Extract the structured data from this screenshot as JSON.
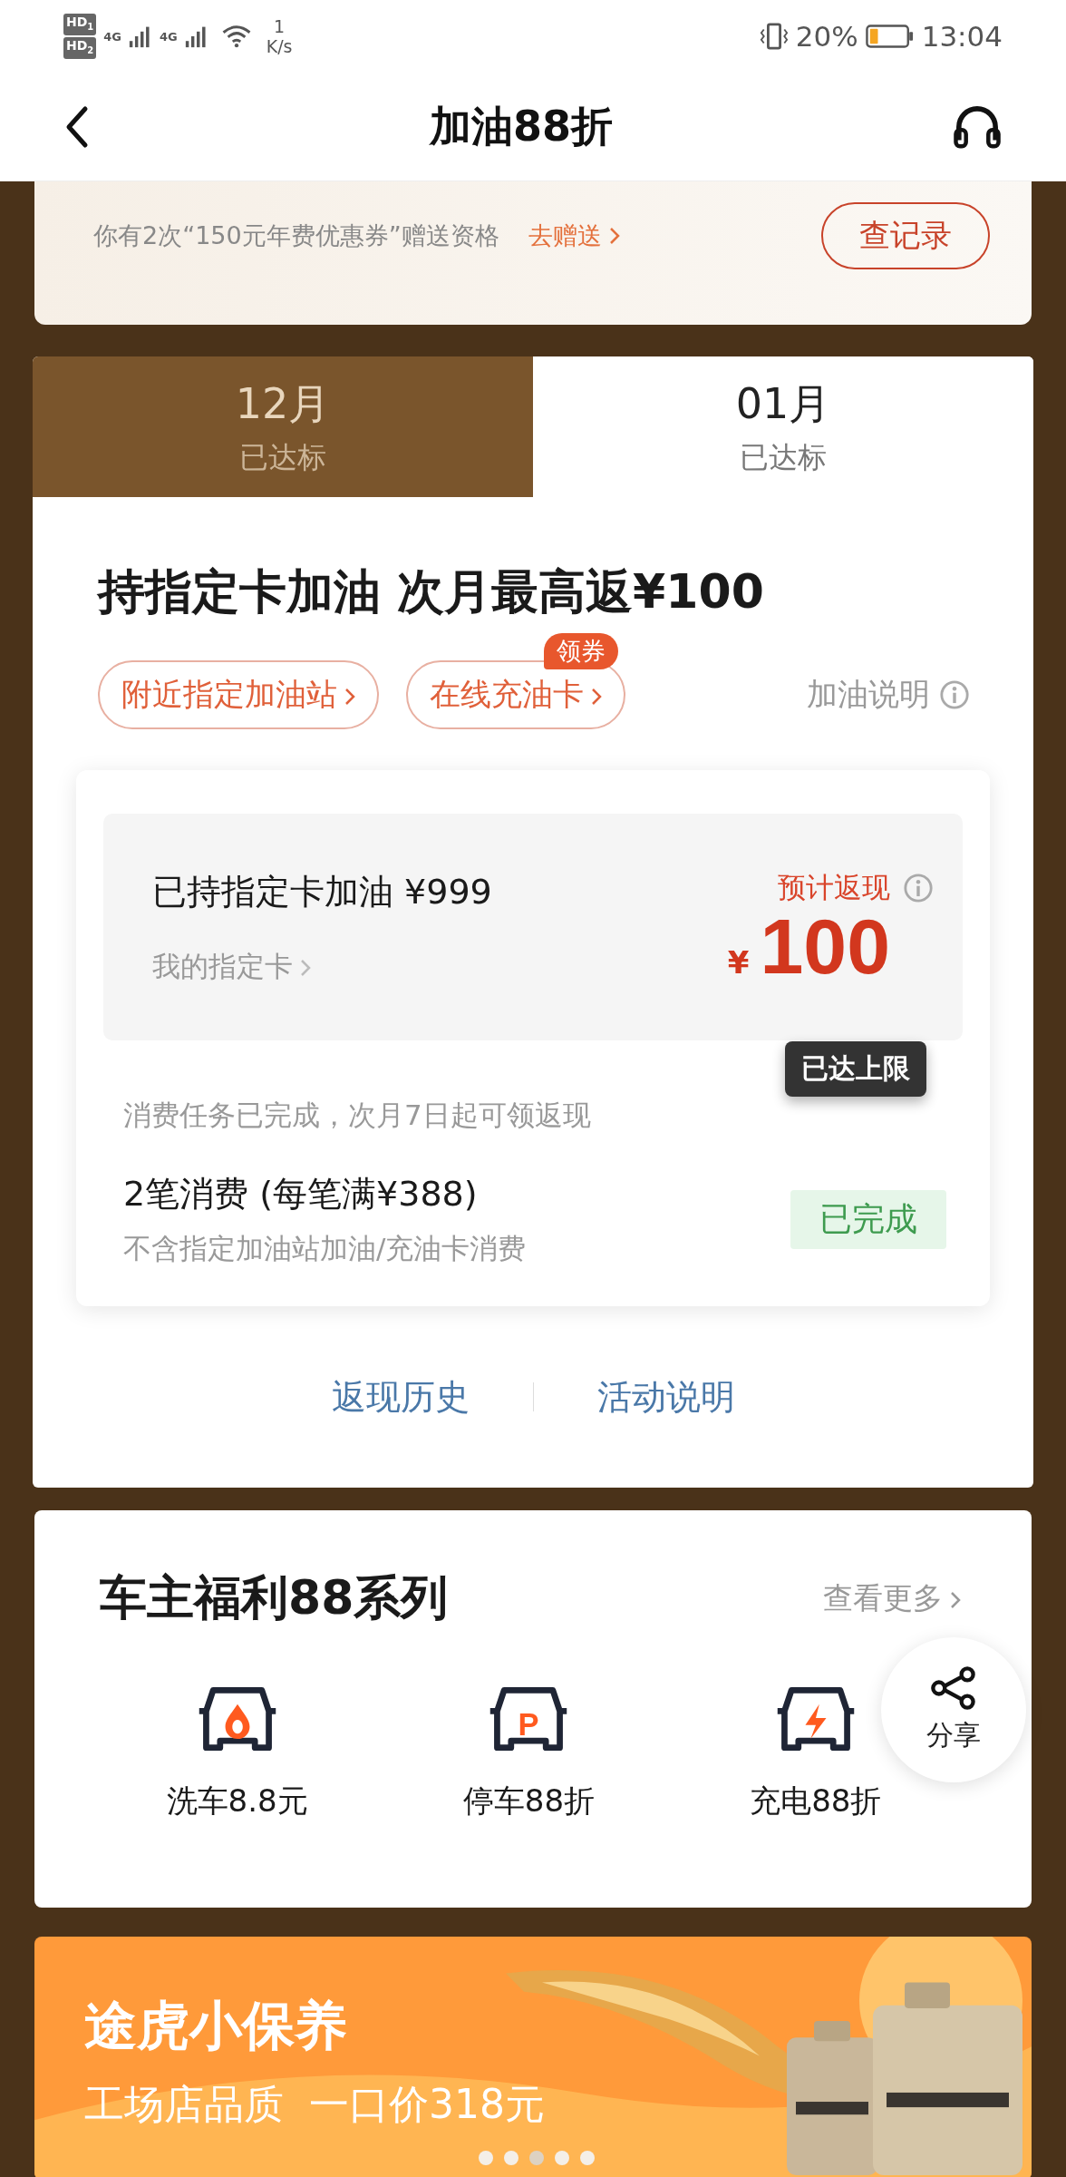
{
  "status_bar": {
    "sims": [
      {
        "badge": "HD",
        "slot": "1"
      },
      {
        "badge": "HD",
        "slot": "2"
      }
    ],
    "networks": [
      "4G",
      "4G"
    ],
    "speed_value": "1",
    "speed_unit": "K/s",
    "battery_text": "20%",
    "time": "13:04"
  },
  "header": {
    "title": "加油88折"
  },
  "promo": {
    "text": "你有2次“150元年费优惠券”赠送资格",
    "link": "去赠送",
    "button": "查记录"
  },
  "month_tabs": [
    {
      "month": "12月",
      "status": "已达标",
      "selected": false
    },
    {
      "month": "01月",
      "status": "已达标",
      "selected": true
    }
  ],
  "fuel": {
    "title": "持指定卡加油 次月最高返¥100",
    "chips": [
      {
        "label": "附近指定加油站"
      },
      {
        "label": "在线充油卡",
        "badge": "领券"
      }
    ],
    "help": "加油说明"
  },
  "rebate": {
    "spent": "已持指定卡加油 ¥999",
    "my_card": "我的指定卡",
    "expected_label": "预计返现",
    "currency": "¥",
    "amount": "100",
    "tooltip": "已达上限"
  },
  "notice": "消费任务已完成，次月7日起可领返现",
  "task": {
    "title": "2笔消费 (每笔满¥388)",
    "subtitle": "不含指定加油站加油/充油卡消费",
    "status": "已完成",
    "done": true
  },
  "links": [
    "返现历史",
    "活动说明"
  ],
  "benefits": {
    "title": "车主福利88系列",
    "more": "查看更多",
    "items": [
      {
        "kind": "wash",
        "label": "洗车8.8元"
      },
      {
        "kind": "parking",
        "glyph": "P",
        "label": "停车88折"
      },
      {
        "kind": "charging",
        "label": "充电88折"
      }
    ]
  },
  "share": {
    "label": "分享"
  },
  "banner": {
    "title": "途虎小保养",
    "subtitle": "工场店品质  一口价318元",
    "dots": [
      {
        "selected": false
      },
      {
        "selected": false
      },
      {
        "selected": true
      },
      {
        "selected": false
      },
      {
        "selected": false
      }
    ]
  }
}
